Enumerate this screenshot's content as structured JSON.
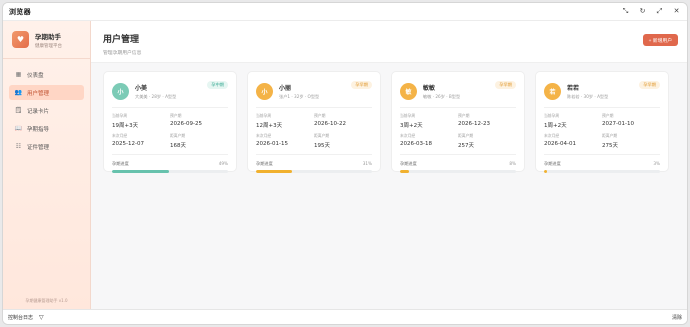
{
  "browser": {
    "title": "浏览器",
    "actions": [
      "⤡",
      "↻",
      "⤢",
      "✕"
    ]
  },
  "sidebar": {
    "brand_name": "孕期助手",
    "brand_sub": "健康管理平台",
    "items": [
      {
        "icon": "▦",
        "label": "仪表盘",
        "active": false
      },
      {
        "icon": "👥",
        "label": "用户管理",
        "active": true
      },
      {
        "icon": "🗒",
        "label": "记录卡片",
        "active": false
      },
      {
        "icon": "📖",
        "label": "孕期指导",
        "active": false
      },
      {
        "icon": "☷",
        "label": "证件管理",
        "active": false
      }
    ],
    "footer": "孕期健康管理助手 v1.0"
  },
  "page": {
    "title": "用户管理",
    "subtitle": "管理孕期用户信息",
    "add_button": "+ 新增用户"
  },
  "users": [
    {
      "avatar": "小",
      "name": "小美",
      "meta": "大美美 · 28岁 · A型型",
      "badge": "孕中期",
      "badge_color": "#2fa68f",
      "badge_bg": "#e6f6f2",
      "avatar_color": "#7ccbb6",
      "current_week_label": "当前孕周",
      "current_week": "19周+3天",
      "due_label": "预产期",
      "due": "2026-09-25",
      "last_label": "末次月经",
      "last": "2025-12-07",
      "remain_label": "距离产期",
      "remain": "168天",
      "progress_label": "孕期进度",
      "progress": 49,
      "progress_text": "49%",
      "progress_color": "#67c2ad"
    },
    {
      "avatar": "小",
      "name": "小丽",
      "meta": "张户1 · 32岁 · O型型",
      "badge": "孕早期",
      "badge_color": "#e0962a",
      "badge_bg": "#fdf2e1",
      "avatar_color": "#f4b347",
      "current_week_label": "当前孕周",
      "current_week": "12周+3天",
      "due_label": "预产期",
      "due": "2026-10-22",
      "last_label": "末次月经",
      "last": "2026-01-15",
      "remain_label": "距离产期",
      "remain": "195天",
      "progress_label": "孕期进度",
      "progress": 31,
      "progress_text": "31%",
      "progress_color": "#f1b12f"
    },
    {
      "avatar": "敏",
      "name": "敏敏",
      "meta": "敏敏 · 26岁 · B型型",
      "badge": "孕早期",
      "badge_color": "#e0962a",
      "badge_bg": "#fdf2e1",
      "avatar_color": "#f4b347",
      "current_week_label": "当前孕周",
      "current_week": "3周+2天",
      "due_label": "预产期",
      "due": "2026-12-23",
      "last_label": "末次月经",
      "last": "2026-03-18",
      "remain_label": "距离产期",
      "remain": "257天",
      "progress_label": "孕期进度",
      "progress": 8,
      "progress_text": "8%",
      "progress_color": "#f1b12f"
    },
    {
      "avatar": "若",
      "name": "若若",
      "meta": "陈若若 · 30岁 · A型型",
      "badge": "孕早期",
      "badge_color": "#e0962a",
      "badge_bg": "#fdf2e1",
      "avatar_color": "#f4b347",
      "current_week_label": "当前孕周",
      "current_week": "1周+2天",
      "due_label": "预产期",
      "due": "2027-01-10",
      "last_label": "末次月经",
      "last": "2026-04-01",
      "remain_label": "距离产期",
      "remain": "275天",
      "progress_label": "孕期进度",
      "progress": 3,
      "progress_text": "3%",
      "progress_color": "#f1b12f"
    }
  ],
  "status_bar": {
    "left": "控制台日志",
    "left_icon": "▽",
    "right": "清除"
  }
}
